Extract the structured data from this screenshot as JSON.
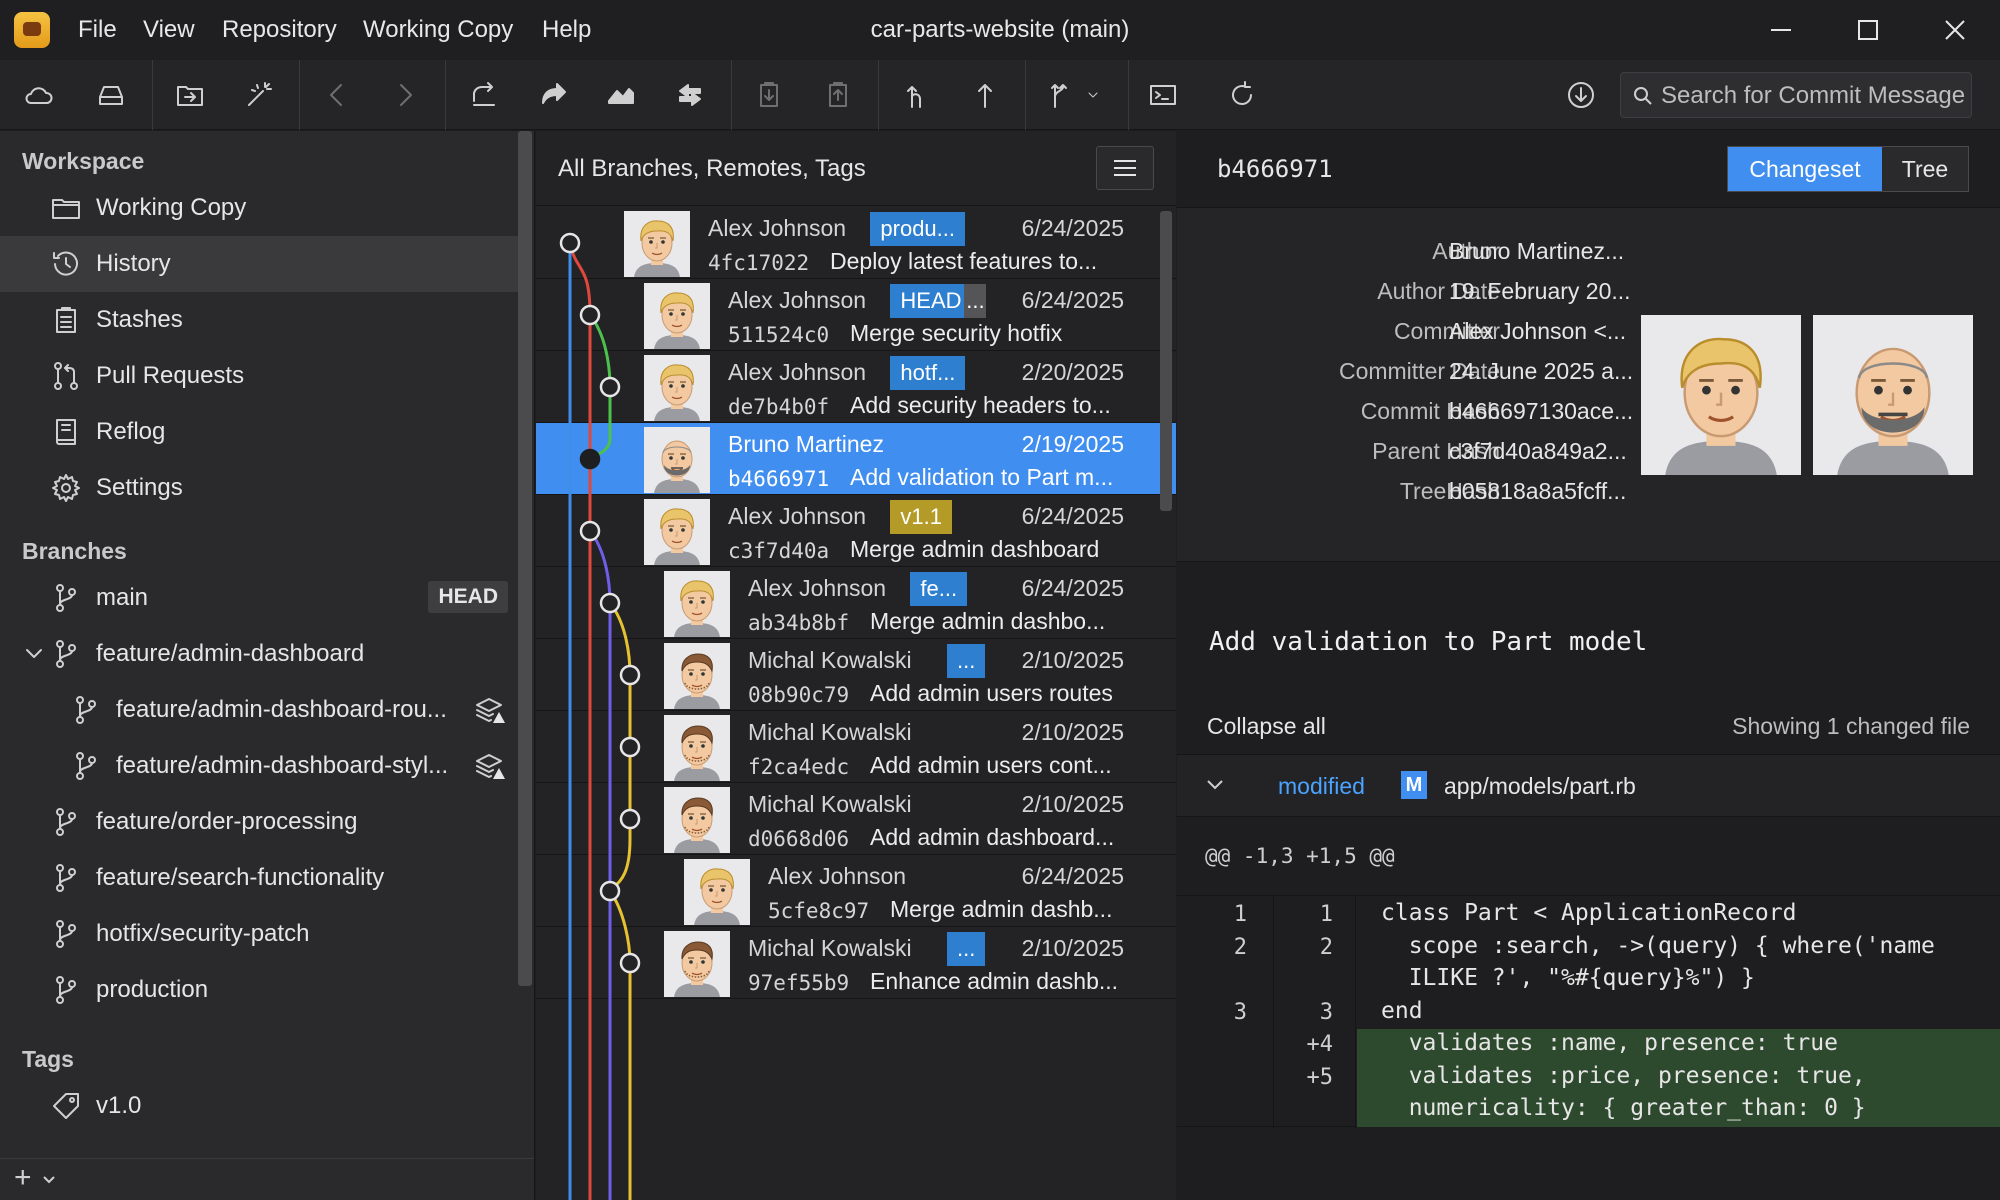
{
  "window": {
    "title": "car-parts-website (main)",
    "menu": [
      "File",
      "View",
      "Repository",
      "Working Copy",
      "Help"
    ]
  },
  "toolbar": {
    "icons": [
      "cloud-icon",
      "drive-icon",
      "folder-arrow-icon",
      "magic-wand-icon",
      "back-icon",
      "forward-icon",
      "pull-icon",
      "fetch-icon",
      "push-icon",
      "sync-icon",
      "stash-icon",
      "unstash-icon",
      "branch-icon",
      "tag-up-icon",
      "merge-icon",
      "terminal-icon",
      "refresh-icon",
      "download-icon"
    ],
    "search_placeholder": "Search for Commit Message"
  },
  "sidebar": {
    "workspace_header": "Workspace",
    "workspace_items": [
      {
        "label": "Working Copy",
        "icon": "folder-icon"
      },
      {
        "label": "History",
        "icon": "history-icon",
        "selected": true
      },
      {
        "label": "Stashes",
        "icon": "stash-icon"
      },
      {
        "label": "Pull Requests",
        "icon": "pull-request-icon"
      },
      {
        "label": "Reflog",
        "icon": "book-icon"
      },
      {
        "label": "Settings",
        "icon": "gear-icon"
      }
    ],
    "branches_header": "Branches",
    "branches": [
      {
        "label": "main",
        "badge": "HEAD"
      },
      {
        "label": "feature/admin-dashboard",
        "expanded": true
      },
      {
        "label": "feature/admin-dashboard-rou...",
        "child": true,
        "warning": true
      },
      {
        "label": "feature/admin-dashboard-styl...",
        "child": true,
        "warning": true
      },
      {
        "label": "feature/order-processing"
      },
      {
        "label": "feature/search-functionality"
      },
      {
        "label": "hotfix/security-patch"
      },
      {
        "label": "production"
      }
    ],
    "tags_header": "Tags",
    "tags": [
      {
        "label": "v1.0"
      }
    ],
    "footer_add": "+"
  },
  "history": {
    "filter_label": "All Branches, Remotes, Tags",
    "commits": [
      {
        "author": "Alex Johnson",
        "badges": [
          {
            "text": "produ...",
            "color": "blue"
          }
        ],
        "date": "6/24/2025",
        "hash": "4fc17022",
        "message": "Deploy latest features to...",
        "avatar": "alex"
      },
      {
        "author": "Alex Johnson",
        "badges": [
          {
            "text": "HEAD",
            "color": "blue"
          },
          {
            "text": "...",
            "color": "grey"
          }
        ],
        "date": "6/24/2025",
        "hash": "511524c0",
        "message": "Merge security hotfix",
        "avatar": "alex"
      },
      {
        "author": "Alex Johnson",
        "badges": [
          {
            "text": "hotf...",
            "color": "blue"
          }
        ],
        "date": "2/20/2025",
        "hash": "de7b4b0f",
        "message": "Add security headers to...",
        "avatar": "alex"
      },
      {
        "author": "Bruno Martinez",
        "badges": [],
        "date": "2/19/2025",
        "hash": "b4666971",
        "message": "Add validation to Part m...",
        "avatar": "bruno",
        "selected": true
      },
      {
        "author": "Alex Johnson",
        "badges": [
          {
            "text": "v1.1",
            "color": "gold"
          }
        ],
        "date": "6/24/2025",
        "hash": "c3f7d40a",
        "message": "Merge admin dashboard",
        "avatar": "alex"
      },
      {
        "author": "Alex Johnson",
        "badges": [
          {
            "text": "fe...",
            "color": "blue"
          }
        ],
        "date": "6/24/2025",
        "hash": "ab34b8bf",
        "message": "Merge admin dashbo...",
        "avatar": "alex"
      },
      {
        "author": "Michal Kowalski",
        "badges": [
          {
            "text": "...",
            "color": "blue"
          }
        ],
        "date": "2/10/2025",
        "hash": "08b90c79",
        "message": "Add admin users routes",
        "avatar": "michal"
      },
      {
        "author": "Michal Kowalski",
        "badges": [],
        "date": "2/10/2025",
        "hash": "f2ca4edc",
        "message": "Add admin users cont...",
        "avatar": "michal"
      },
      {
        "author": "Michal Kowalski",
        "badges": [],
        "date": "2/10/2025",
        "hash": "d0668d06",
        "message": "Add admin dashboard...",
        "avatar": "michal"
      },
      {
        "author": "Alex Johnson",
        "badges": [],
        "date": "6/24/2025",
        "hash": "5cfe8c97",
        "message": "Merge admin dashb...",
        "avatar": "alex"
      },
      {
        "author": "Michal Kowalski",
        "badges": [
          {
            "text": "...",
            "color": "blue"
          }
        ],
        "date": "2/10/2025",
        "hash": "97ef55b9",
        "message": "Enhance admin dashb...",
        "avatar": "michal"
      }
    ]
  },
  "details": {
    "short_hash": "b4666971",
    "view_tabs": {
      "changeset": "Changeset",
      "tree": "Tree"
    },
    "meta": [
      {
        "key": "Author",
        "value": "Bruno Martinez..."
      },
      {
        "key": "Author Date",
        "value": "19. February 20..."
      },
      {
        "key": "Committer",
        "value": "Alex Johnson <..."
      },
      {
        "key": "Committer Date",
        "value": "24. June 2025 a..."
      },
      {
        "key": "Commit Hash",
        "value": "b466697130ace..."
      },
      {
        "key": "Parent Hash",
        "value": "c3f7d40a849a2..."
      },
      {
        "key": "TreeHash",
        "value": "b05818a8a5fcff..."
      }
    ],
    "commit_message": "Add validation to Part model",
    "collapse_all": "Collapse all",
    "changed_files": "Showing 1 changed file",
    "file": {
      "status": "modified",
      "badge": "M",
      "path": "app/models/part.rb"
    },
    "hunk_header": "@@ -1,3 +1,5 @@",
    "diff_lines": [
      {
        "old": "1",
        "new": "1",
        "text": "class Part < ApplicationRecord",
        "added": false
      },
      {
        "old": "2",
        "new": "2",
        "text": "  scope :search, ->(query) { where('name",
        "added": false
      },
      {
        "old": "",
        "new": "",
        "text": "  ILIKE ?', \"%#{query}%\") }",
        "added": false
      },
      {
        "old": "3",
        "new": "3",
        "text": "end",
        "added": false
      },
      {
        "old": "",
        "new": "+4",
        "text": "  validates :name, presence: true",
        "added": true
      },
      {
        "old": "",
        "new": "+5",
        "text": "  validates :price, presence: true,",
        "added": true
      },
      {
        "old": "",
        "new": "",
        "text": "  numericality: { greater_than: 0 }",
        "added": true
      }
    ]
  },
  "colors": {
    "accent": "#3f8ef0",
    "graph_blue": "#3d8ee8",
    "graph_red": "#e0483d",
    "graph_green": "#4cc24c",
    "graph_purple": "#6f5fe8",
    "graph_yellow": "#e6c231",
    "added_line_bg": "#2e4a2e"
  }
}
